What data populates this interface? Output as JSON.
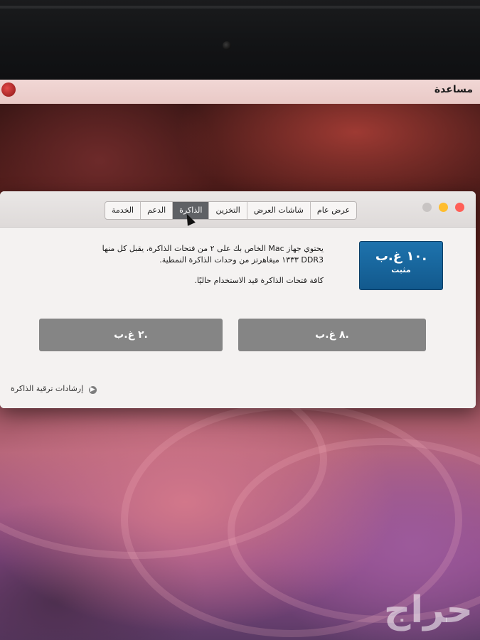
{
  "menubar": {
    "help_label": "مساعدة"
  },
  "window": {
    "tabs": [
      "عرض عام",
      "شاشات العرض",
      "التخزين",
      "الذاكرة",
      "الدعم",
      "الخدمة"
    ],
    "active_tab": "الذاكرة",
    "memory_total": "١٠ غ.ب.",
    "memory_status": "مثبت",
    "description_line1": "يحتوي جهاز Mac الخاص بك على ٢ من فتحات الذاكرة، يقبل كل منها",
    "description_line2": "DDR3 ١٣٣٣ ميغاهرتز من وحدات الذاكرة النمطية.",
    "slots_status": "كافة فتحات الذاكرة قيد الاستخدام حاليًا.",
    "slot_left": "٢ غ.ب.",
    "slot_right": "٨ غ.ب.",
    "upgrade_link": "إرشادات ترقية الذاكرة"
  },
  "watermark": "حراج",
  "colors": {
    "close": "#ff5f57",
    "minimize": "#ffbd2e",
    "zoom": "#c8c4c3",
    "memory_box": "#1668a1",
    "slot_bar": "#858585"
  }
}
